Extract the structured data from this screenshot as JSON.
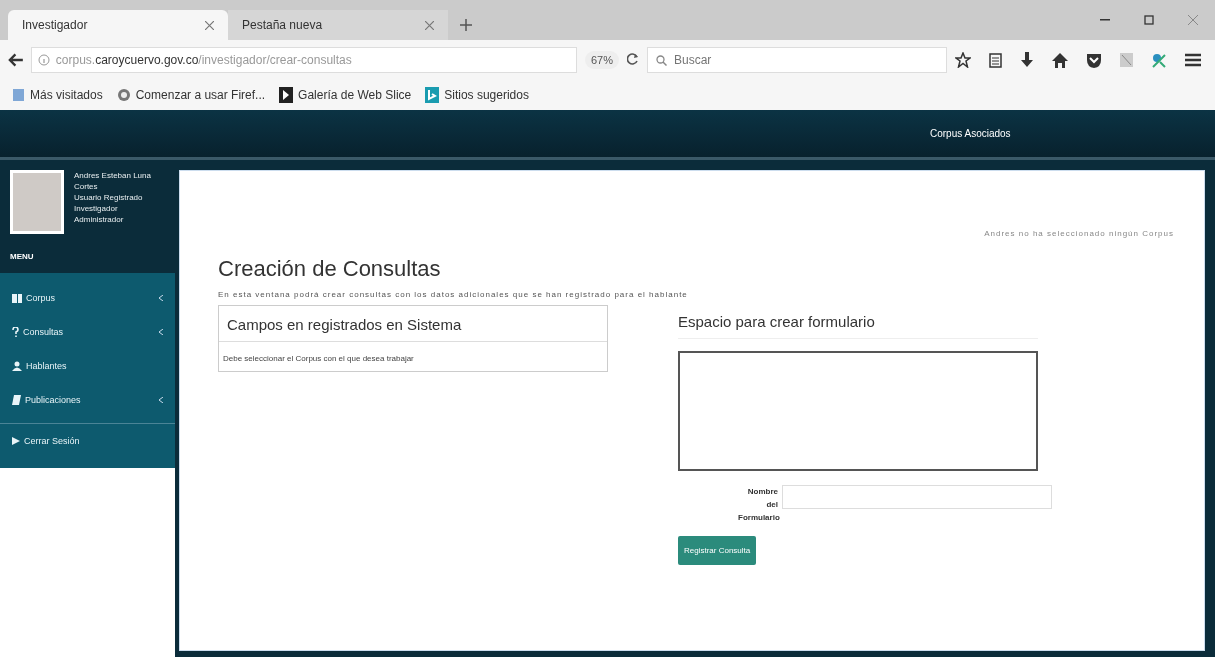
{
  "browser": {
    "tabs": [
      {
        "label": "Investigador",
        "selected": true
      },
      {
        "label": "Pestaña nueva",
        "selected": false
      }
    ],
    "address": {
      "prefix": "corpus.",
      "domain": "caroycuervo.gov.co",
      "path": "/investigador/crear-consultas"
    },
    "zoom": "67%",
    "search": {
      "placeholder": "Buscar"
    },
    "bookmarks": [
      {
        "label": "Más visitados"
      },
      {
        "label": "Comenzar a usar Firef..."
      },
      {
        "label": "Galería de Web Slice"
      },
      {
        "label": "Sitios sugeridos"
      }
    ]
  },
  "header": {
    "link": "Corpus Asociados"
  },
  "sidebar": {
    "user": [
      "Andres Esteban Luna Cortes",
      "Usuario Registrado",
      "Investigador",
      "Administrador"
    ],
    "menu_title": "MENU",
    "items": [
      {
        "label": "Corpus",
        "submenu": true
      },
      {
        "label": "Consultas",
        "submenu": true
      },
      {
        "label": "Hablantes",
        "submenu": false
      },
      {
        "label": "Publicaciones",
        "submenu": true
      }
    ],
    "logout": {
      "label": "Cerrar Sesión"
    }
  },
  "main": {
    "notice": "Andres no ha seleccionado ningún Corpus",
    "title": "Creación de Consultas",
    "description": "En esta ventana podrá crear consultas con los datos adicionales que se han registrado para el hablante",
    "fields_panel": {
      "title": "Campos en registrados en Sistema",
      "message": "Debe seleccionar el Corpus con el que desea trabajar"
    },
    "form_panel": {
      "title": "Espacio para crear formulario",
      "name_label": "Nombre del Formulario",
      "submit": "Registrar Consulta"
    }
  }
}
